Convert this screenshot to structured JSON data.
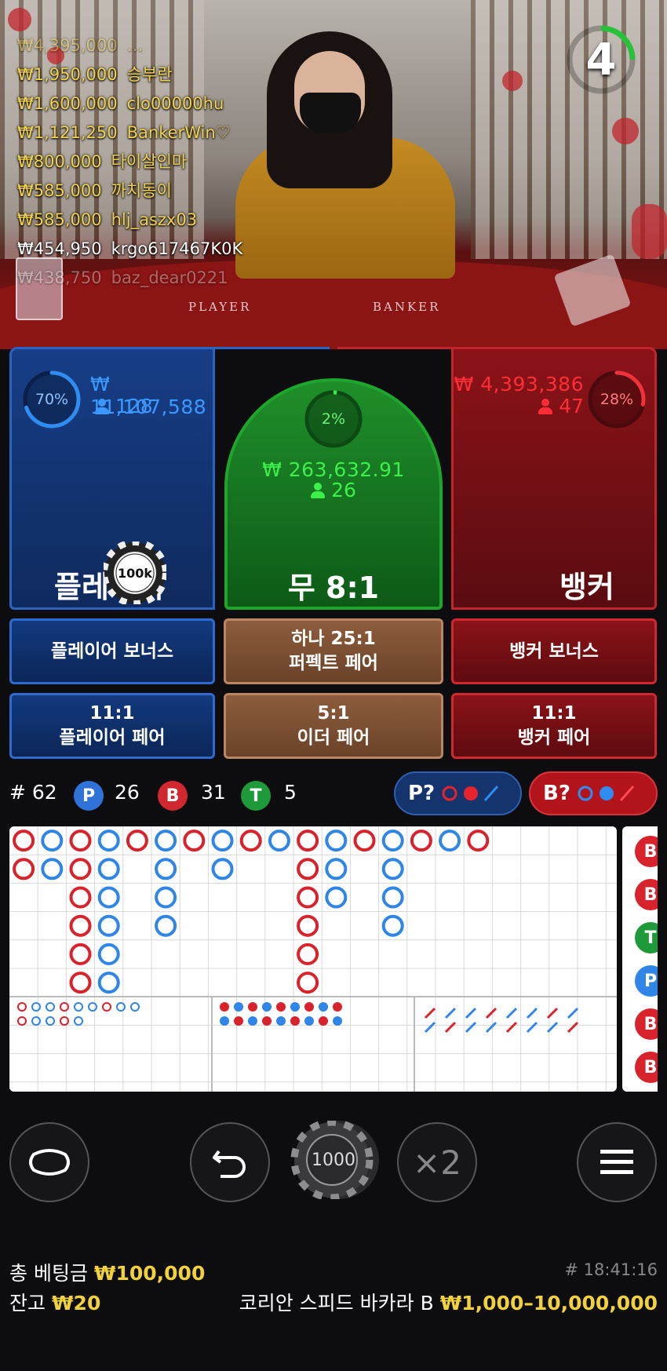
{
  "video": {
    "table_labels": {
      "player": "PLAYER",
      "banker": "BANKER"
    },
    "countdown": "4",
    "chat": [
      {
        "amount": "₩4,395,000",
        "user": "…",
        "style": "fade-top"
      },
      {
        "amount": "₩1,950,000",
        "user": "승부란",
        "style": ""
      },
      {
        "amount": "₩1,600,000",
        "user": "clo00000hu",
        "style": ""
      },
      {
        "amount": "₩1,121,250",
        "user": "BankerWin♡",
        "style": ""
      },
      {
        "amount": "₩800,000",
        "user": "타이살인마",
        "style": ""
      },
      {
        "amount": "₩585,000",
        "user": "까치동이",
        "style": ""
      },
      {
        "amount": "₩585,000",
        "user": "hlj_aszx03",
        "style": ""
      },
      {
        "amount": "₩454,950",
        "user": "krgo617467K0K",
        "style": "white"
      },
      {
        "amount": "₩438,750",
        "user": "baz_dear0221",
        "style": "white fade-bot"
      }
    ]
  },
  "bets": {
    "player": {
      "percent": 70,
      "percent_label": "70%",
      "amount": "₩ 11,107,588",
      "count": "128",
      "label": "플레이어"
    },
    "tie": {
      "percent": 2,
      "percent_label": "2%",
      "amount": "₩ 263,632.91",
      "count": "26",
      "label": "무 8:1"
    },
    "banker": {
      "percent": 28,
      "percent_label": "28%",
      "amount": "₩ 4,393,386",
      "count": "47",
      "label": "뱅커"
    },
    "chip_on_player": "100k"
  },
  "side_bets": {
    "player_bonus": "플레이어 보너스",
    "perfect_pair_line1": "하나 25:1",
    "perfect_pair_line2": "퍼펙트 페어",
    "banker_bonus": "뱅커 보너스",
    "player_pair_line1": "11:1",
    "player_pair_line2": "플레이어 페어",
    "either_pair_line1": "5:1",
    "either_pair_line2": "이더 페어",
    "banker_pair_line1": "11:1",
    "banker_pair_line2": "뱅커 페어"
  },
  "stats": {
    "rounds": "# 62",
    "player_badge": "P",
    "player_wins": "26",
    "banker_badge": "B",
    "banker_wins": "31",
    "tie_badge": "T",
    "ties": "5",
    "player_predict": "P?",
    "banker_predict": "B?"
  },
  "roadmap": {
    "big_road": [
      [
        "B",
        "B"
      ],
      [
        "P",
        "P"
      ],
      [
        "B",
        "B",
        "B",
        "B",
        "B",
        "B"
      ],
      [
        "P",
        "P",
        "P",
        "P",
        "P",
        "P"
      ],
      [
        "B"
      ],
      [
        "P",
        "P",
        "P",
        "P"
      ],
      [
        "B"
      ],
      [
        "P",
        "P"
      ],
      [
        "B"
      ],
      [
        "P"
      ],
      [
        "B",
        "B",
        "B",
        "B",
        "B",
        "B"
      ],
      [
        "P",
        "P",
        "P"
      ],
      [
        "B"
      ],
      [
        "P",
        "P",
        "P",
        "P"
      ],
      [
        "B"
      ],
      [
        "P"
      ],
      [
        "B"
      ]
    ],
    "side_column": [
      "B",
      "B",
      "T",
      "P",
      "B",
      "B"
    ]
  },
  "controls": {
    "chip_value": "1000",
    "double_label": "×2"
  },
  "footer": {
    "total_bet_label": "총 베팅금",
    "total_bet_value": "₩100,000",
    "round_id": "# 18:41:16",
    "balance_label": "잔고",
    "balance_value": "₩20",
    "table_name": "코리안 스피드 바카라 B",
    "limits": "₩1,000–10,000,000"
  },
  "colors": {
    "player": "#2f6ad0",
    "banker": "#d1272f",
    "tie": "#1da62b",
    "highlight": "#f2d23c"
  }
}
